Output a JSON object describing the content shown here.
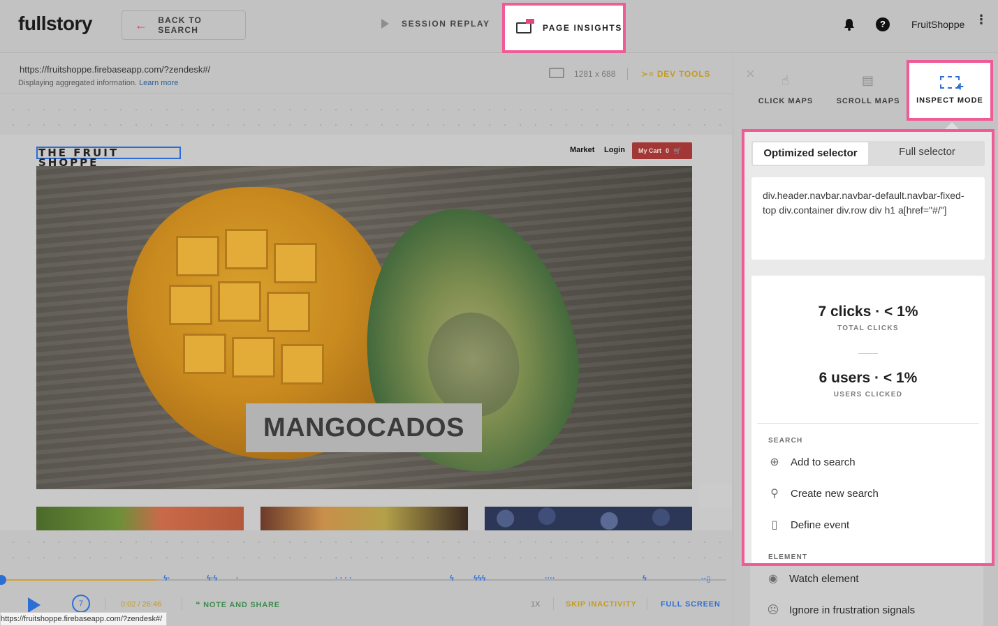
{
  "header": {
    "logo": "fullstory",
    "back_label": "BACK TO SEARCH",
    "session_replay": "SESSION REPLAY",
    "page_insights": "PAGE INSIGHTS",
    "help": "?",
    "account": "FruitShoppe",
    "kebab": "⋮"
  },
  "info": {
    "url": "https://fruitshoppe.firebaseapp.com/?zendesk#/",
    "aggregated": "Displaying aggregated information.",
    "learn_more": "Learn more",
    "resolution": "1281 x 688",
    "dev_tools": "DEV TOOLS"
  },
  "site": {
    "title": "THE FRUIT SHOPPE",
    "market": "Market",
    "login": "Login",
    "cart": "My Cart",
    "cart_count": "0",
    "hero_label": "MANGOCADOS"
  },
  "player": {
    "rewind_seconds": "7",
    "time": "0:02 / 26:46",
    "note_and_share": "NOTE AND SHARE",
    "speed": "1X",
    "skip_inactivity": "SKIP INACTIVITY",
    "full_screen": "FULL SCREEN",
    "status_url": "https://fruitshoppe.firebaseapp.com/?zendesk#/",
    "progress": 0.21
  },
  "panel": {
    "close": "×",
    "modes": [
      "CLICK MAPS",
      "SCROLL MAPS",
      "INSPECT MODE"
    ],
    "selector_tabs": [
      "Optimized selector",
      "Full selector"
    ],
    "selector_text": "div.header.navbar.navbar-default.navbar-fixed-top div.container div.row div h1 a[href=\"#/\"]",
    "clicks": "7 clicks · < 1%",
    "clicks_label": "TOTAL CLICKS",
    "users": "6 users · < 1%",
    "users_label": "USERS CLICKED",
    "search_title": "SEARCH",
    "add_to_search": "Add to search",
    "create_new_search": "Create new search",
    "define_event": "Define event",
    "element_title": "ELEMENT",
    "watch_element": "Watch element",
    "ignore_frustration": "Ignore in frustration signals"
  },
  "colors": {
    "highlight": "#ef5b96",
    "link_blue": "#2d6ed5",
    "gold": "#c59b20",
    "green": "#3e8c4e",
    "cart_red": "#a23836"
  }
}
